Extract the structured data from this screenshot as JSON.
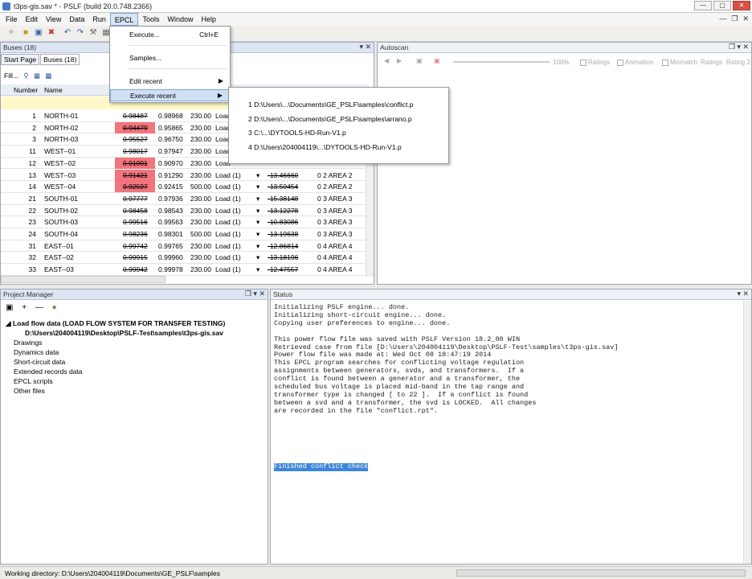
{
  "window": {
    "title": "t3ps-gis.sav * - PSLF (build 20.0.748.2366)"
  },
  "menubar": [
    "File",
    "Edit",
    "View",
    "Data",
    "Run",
    "EPCL",
    "Tools",
    "Window",
    "Help"
  ],
  "buses_panel": {
    "title": "Buses (18)",
    "tabs": [
      "Start Page",
      "Buses (18)"
    ],
    "fill_label": "Fill...",
    "col_number": "Number",
    "col_name": "Name",
    "rows": [
      {
        "num": "1",
        "name": "NORTH-01",
        "v1": "0.98487",
        "v2": "0.98968",
        "kv": "230.00",
        "type": "Load",
        "hl": false
      },
      {
        "num": "2",
        "name": "NORTH-02",
        "v1": "0.94479",
        "v2": "0.95865",
        "kv": "230.00",
        "type": "Load",
        "hl": true
      },
      {
        "num": "3",
        "name": "NORTH-03",
        "v1": "0.95527",
        "v2": "0.96750",
        "kv": "230.00",
        "type": "Load",
        "hl": false
      },
      {
        "num": "11",
        "name": "WEST--01",
        "v1": "0.98017",
        "v2": "0.97947",
        "kv": "230.00",
        "type": "Load",
        "hl": false
      },
      {
        "num": "12",
        "name": "WEST--02",
        "v1": "0.91091",
        "v2": "0.90970",
        "kv": "230.00",
        "type": "Load",
        "hl": true
      },
      {
        "num": "13",
        "name": "WEST--03",
        "v1": "0.91421",
        "v2": "0.91290",
        "kv": "230.00",
        "type": "Load (1)",
        "ang": "-13.46660",
        "area": "0 2 AREA 2",
        "hl": true
      },
      {
        "num": "14",
        "name": "WEST--04",
        "v1": "0.92597",
        "v2": "0.92415",
        "kv": "500.00",
        "type": "Load (1)",
        "ang": "-13.50454",
        "area": "0 2 AREA 2",
        "hl": true
      },
      {
        "num": "21",
        "name": "SOUTH-01",
        "v1": "0.97777",
        "v2": "0.97936",
        "kv": "230.00",
        "type": "Load (1)",
        "ang": "-15.38148",
        "area": "0 3 AREA 3",
        "hl": false
      },
      {
        "num": "22",
        "name": "SOUTH-02",
        "v1": "0.98458",
        "v2": "0.98543",
        "kv": "230.00",
        "type": "Load (1)",
        "ang": "-13.12278",
        "area": "0 3 AREA 3",
        "hl": false
      },
      {
        "num": "23",
        "name": "SOUTH-03",
        "v1": "0.99516",
        "v2": "0.99563",
        "kv": "230.00",
        "type": "Load (1)",
        "ang": "-10.83086",
        "area": "0 3 AREA 3",
        "hl": false
      },
      {
        "num": "24",
        "name": "SOUTH-04",
        "v1": "0.98236",
        "v2": "0.98301",
        "kv": "500.00",
        "type": "Load (1)",
        "ang": "-13.19638",
        "area": "0 3 AREA 3",
        "hl": false
      },
      {
        "num": "31",
        "name": "EAST--01",
        "v1": "0.99742",
        "v2": "0.99765",
        "kv": "230.00",
        "type": "Load (1)",
        "ang": "-12.86814",
        "area": "0 4 AREA 4",
        "hl": false
      },
      {
        "num": "32",
        "name": "EAST--02",
        "v1": "0.99915",
        "v2": "0.99960",
        "kv": "230.00",
        "type": "Load (1)",
        "ang": "-13.18196",
        "area": "0 4 AREA 4",
        "hl": false
      },
      {
        "num": "33",
        "name": "EAST--03",
        "v1": "0.99942",
        "v2": "0.99978",
        "kv": "230.00",
        "type": "Load (1)",
        "ang": "-12.47557",
        "area": "0 4 AREA 4",
        "hl": false
      }
    ]
  },
  "epcl_menu": {
    "execute": "Execute...",
    "execute_shortcut": "Ctrl+E",
    "samples": "Samples...",
    "edit_recent": "Edit recent",
    "execute_recent": "Execute recent"
  },
  "recent_menu": [
    "1 D:\\Users\\...\\Documents\\GE_PSLF\\samples\\conflict.p",
    "2 D:\\Users\\...\\Documents\\GE_PSLF\\samples\\arrano.p",
    "3 C:\\...\\DYTOOLS-HD-Run-V1.p",
    "4 D:\\Users\\204004119\\...\\DYTOOLS-HD-Run-V1.p"
  ],
  "autoscan": {
    "title": "Autoscan",
    "zoom": "100%",
    "ratings": "Ratings",
    "animation": "Animation",
    "mismatch": "Mismatch",
    "ratings2": "Ratings",
    "rating2": "Rating 2"
  },
  "project_manager": {
    "title": "Project Manager",
    "root": "Load flow data (LOAD FLOW SYSTEM FOR TRANSFER TESTING)",
    "path": "D:\\Users\\204004119\\Desktop\\PSLF-Test\\samples\\t3ps-gis.sav",
    "items": [
      "Drawings",
      "Dynamics data",
      "Short-circuit data",
      "Extended records data",
      "EPCL scripts",
      "Other files"
    ]
  },
  "status": {
    "title": "Status",
    "lines": "Initializing PSLF engine... done.\nInitializing short-circuit engine... done.\nCopying user preferences to engine... done.\n\nThis power flow file was saved with PSLF Version 18.2_00 WIN\nRetrieved case from file [D:\\Users\\204004119\\Desktop\\PSLF-Test\\samples\\t3ps-gis.sav]\nPower flow file was made at: Wed Oct 08 18:47:19 2014\nThis EPCL program searches for conflicting voltage regulation\nassignments between generators, svds, and transformers.  If a\nconflict is found between a generator and a transformer, the\nscheduled bus voltage is placed mid-band in the tap range and\ntransformer type is changed [ to 22 ].  If a conflict is found\nbetween a svd and a transformer, the svd is LOCKED.  All changes\nare recorded in the file \"conflict.rpt\".",
    "finished": "Finished conflict check"
  },
  "statusbar": {
    "text": "Working directory: D:\\Users\\204004119\\Documents\\GE_PSLF\\samples"
  },
  "colors": {
    "highlight": "#f2757d",
    "panel_header": "#dde6f2",
    "selection": "#3d86d8"
  }
}
